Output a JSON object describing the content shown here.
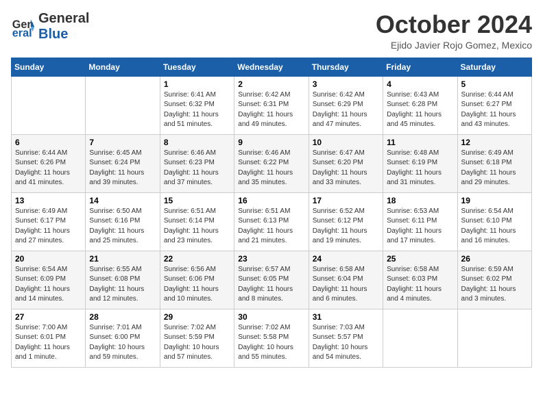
{
  "header": {
    "logo_general": "General",
    "logo_blue": "Blue",
    "month_title": "October 2024",
    "location": "Ejido Javier Rojo Gomez, Mexico"
  },
  "days_of_week": [
    "Sunday",
    "Monday",
    "Tuesday",
    "Wednesday",
    "Thursday",
    "Friday",
    "Saturday"
  ],
  "weeks": [
    [
      {
        "day": "",
        "info": ""
      },
      {
        "day": "",
        "info": ""
      },
      {
        "day": "1",
        "info": "Sunrise: 6:41 AM\nSunset: 6:32 PM\nDaylight: 11 hours and 51 minutes."
      },
      {
        "day": "2",
        "info": "Sunrise: 6:42 AM\nSunset: 6:31 PM\nDaylight: 11 hours and 49 minutes."
      },
      {
        "day": "3",
        "info": "Sunrise: 6:42 AM\nSunset: 6:29 PM\nDaylight: 11 hours and 47 minutes."
      },
      {
        "day": "4",
        "info": "Sunrise: 6:43 AM\nSunset: 6:28 PM\nDaylight: 11 hours and 45 minutes."
      },
      {
        "day": "5",
        "info": "Sunrise: 6:44 AM\nSunset: 6:27 PM\nDaylight: 11 hours and 43 minutes."
      }
    ],
    [
      {
        "day": "6",
        "info": "Sunrise: 6:44 AM\nSunset: 6:26 PM\nDaylight: 11 hours and 41 minutes."
      },
      {
        "day": "7",
        "info": "Sunrise: 6:45 AM\nSunset: 6:24 PM\nDaylight: 11 hours and 39 minutes."
      },
      {
        "day": "8",
        "info": "Sunrise: 6:46 AM\nSunset: 6:23 PM\nDaylight: 11 hours and 37 minutes."
      },
      {
        "day": "9",
        "info": "Sunrise: 6:46 AM\nSunset: 6:22 PM\nDaylight: 11 hours and 35 minutes."
      },
      {
        "day": "10",
        "info": "Sunrise: 6:47 AM\nSunset: 6:20 PM\nDaylight: 11 hours and 33 minutes."
      },
      {
        "day": "11",
        "info": "Sunrise: 6:48 AM\nSunset: 6:19 PM\nDaylight: 11 hours and 31 minutes."
      },
      {
        "day": "12",
        "info": "Sunrise: 6:49 AM\nSunset: 6:18 PM\nDaylight: 11 hours and 29 minutes."
      }
    ],
    [
      {
        "day": "13",
        "info": "Sunrise: 6:49 AM\nSunset: 6:17 PM\nDaylight: 11 hours and 27 minutes."
      },
      {
        "day": "14",
        "info": "Sunrise: 6:50 AM\nSunset: 6:16 PM\nDaylight: 11 hours and 25 minutes."
      },
      {
        "day": "15",
        "info": "Sunrise: 6:51 AM\nSunset: 6:14 PM\nDaylight: 11 hours and 23 minutes."
      },
      {
        "day": "16",
        "info": "Sunrise: 6:51 AM\nSunset: 6:13 PM\nDaylight: 11 hours and 21 minutes."
      },
      {
        "day": "17",
        "info": "Sunrise: 6:52 AM\nSunset: 6:12 PM\nDaylight: 11 hours and 19 minutes."
      },
      {
        "day": "18",
        "info": "Sunrise: 6:53 AM\nSunset: 6:11 PM\nDaylight: 11 hours and 17 minutes."
      },
      {
        "day": "19",
        "info": "Sunrise: 6:54 AM\nSunset: 6:10 PM\nDaylight: 11 hours and 16 minutes."
      }
    ],
    [
      {
        "day": "20",
        "info": "Sunrise: 6:54 AM\nSunset: 6:09 PM\nDaylight: 11 hours and 14 minutes."
      },
      {
        "day": "21",
        "info": "Sunrise: 6:55 AM\nSunset: 6:08 PM\nDaylight: 11 hours and 12 minutes."
      },
      {
        "day": "22",
        "info": "Sunrise: 6:56 AM\nSunset: 6:06 PM\nDaylight: 11 hours and 10 minutes."
      },
      {
        "day": "23",
        "info": "Sunrise: 6:57 AM\nSunset: 6:05 PM\nDaylight: 11 hours and 8 minutes."
      },
      {
        "day": "24",
        "info": "Sunrise: 6:58 AM\nSunset: 6:04 PM\nDaylight: 11 hours and 6 minutes."
      },
      {
        "day": "25",
        "info": "Sunrise: 6:58 AM\nSunset: 6:03 PM\nDaylight: 11 hours and 4 minutes."
      },
      {
        "day": "26",
        "info": "Sunrise: 6:59 AM\nSunset: 6:02 PM\nDaylight: 11 hours and 3 minutes."
      }
    ],
    [
      {
        "day": "27",
        "info": "Sunrise: 7:00 AM\nSunset: 6:01 PM\nDaylight: 11 hours and 1 minute."
      },
      {
        "day": "28",
        "info": "Sunrise: 7:01 AM\nSunset: 6:00 PM\nDaylight: 10 hours and 59 minutes."
      },
      {
        "day": "29",
        "info": "Sunrise: 7:02 AM\nSunset: 5:59 PM\nDaylight: 10 hours and 57 minutes."
      },
      {
        "day": "30",
        "info": "Sunrise: 7:02 AM\nSunset: 5:58 PM\nDaylight: 10 hours and 55 minutes."
      },
      {
        "day": "31",
        "info": "Sunrise: 7:03 AM\nSunset: 5:57 PM\nDaylight: 10 hours and 54 minutes."
      },
      {
        "day": "",
        "info": ""
      },
      {
        "day": "",
        "info": ""
      }
    ]
  ]
}
